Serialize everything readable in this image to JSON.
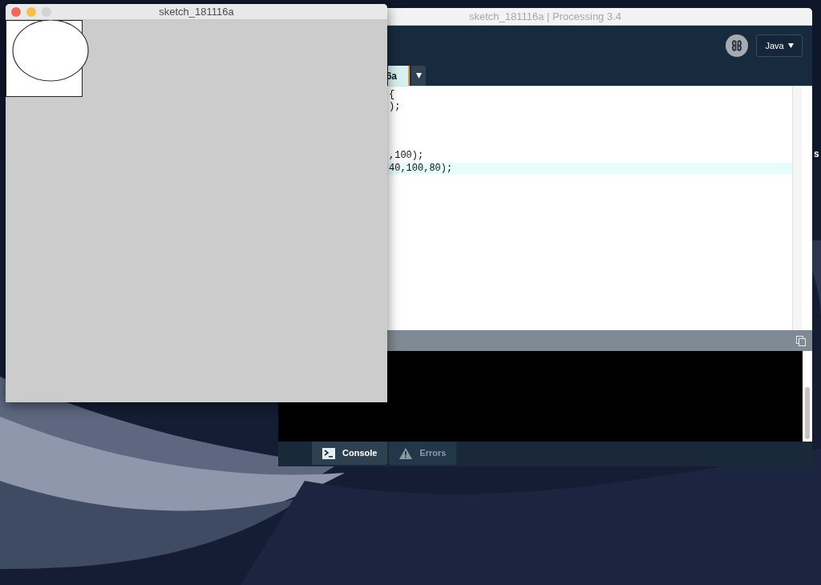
{
  "desktop": {
    "label": "s"
  },
  "editor_window": {
    "title": "sketch_181116a | Processing 3.4",
    "mode": "Java",
    "tab": {
      "label": "6a",
      "selected": true
    },
    "code_lines": [
      {
        "text": "{",
        "highlighted": false
      },
      {
        "text": ");",
        "highlighted": false
      },
      {
        "highlighted": false
      },
      {
        "highlighted": false
      },
      {
        "highlighted": false
      },
      {
        "text": ",100);",
        "highlighted": false
      },
      {
        "text": "40,100,80);",
        "highlighted": true
      }
    ],
    "console_tabs": [
      {
        "label": "Console",
        "selected": true,
        "kind": "console"
      },
      {
        "label": "Errors",
        "selected": false,
        "kind": "errors"
      }
    ]
  },
  "sketch_window": {
    "title": "sketch_181116a"
  }
}
